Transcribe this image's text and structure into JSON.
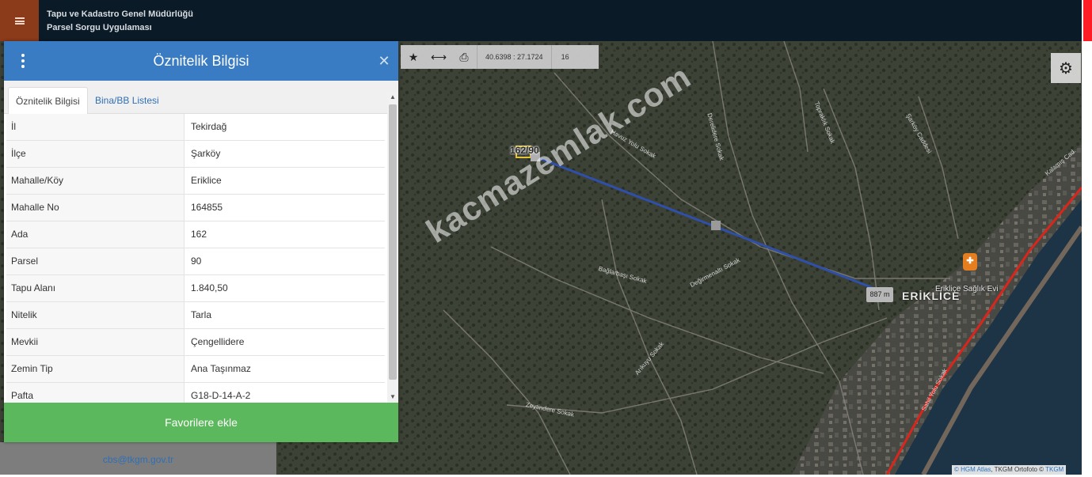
{
  "header": {
    "title_line1": "Tapu ve Kadastro Genel Müdürlüğü",
    "title_line2": "Parsel Sorgu Uygulaması",
    "menu_icon": "hamburger-icon"
  },
  "toolbar": {
    "icons": [
      "star-icon",
      "measure-icon",
      "print-icon"
    ],
    "coordinates": "40.6398 : 27.1724",
    "zoom": "16",
    "settings_icon": "gear-icon"
  },
  "map": {
    "parcel_label": "162/90",
    "distance_label": "887 m",
    "place_label": "ERİKLİCE",
    "poi_label": "Erikliçe Sağlık Evi",
    "watermark": "kacmazemlak.com",
    "streets": [
      "Havuz Yolu Sokak",
      "Derelidere Sokak",
      "Topraklık Sokak",
      "Şarköy Caddesi",
      "Değirmenaltı Sokak",
      "Bağlarbaşı Sokak",
      "Arıkuyu Sokak",
      "Zeytindere Sokak",
      "Sahil Yolu Sokak",
      "Kalamış Cad."
    ],
    "attribution_hgm": "© HGM Atlas",
    "attribution_rest": ", TKGM Ortofoto © ",
    "attribution_tkgm": "TKGM",
    "colors": {
      "measure_line": "#2f4fa8",
      "parcel_outline": "#e8c43a",
      "coast_line": "#d9261c",
      "sea": "#1d3346"
    }
  },
  "panel": {
    "title": "Öznitelik Bilgisi",
    "close_icon": "close-icon",
    "tabs": [
      {
        "label": "Öznitelik Bilgisi",
        "active": true
      },
      {
        "label": "Bina/BB Listesi",
        "active": false
      }
    ],
    "rows": [
      {
        "key": "İl",
        "value": "Tekirdağ"
      },
      {
        "key": "İlçe",
        "value": "Şarköy"
      },
      {
        "key": "Mahalle/Köy",
        "value": "Eriklice"
      },
      {
        "key": "Mahalle No",
        "value": "164855"
      },
      {
        "key": "Ada",
        "value": "162"
      },
      {
        "key": "Parsel",
        "value": "90"
      },
      {
        "key": "Tapu Alanı",
        "value": "1.840,50"
      },
      {
        "key": "Nitelik",
        "value": "Tarla"
      },
      {
        "key": "Mevkii",
        "value": "Çengellidere"
      },
      {
        "key": "Zemin Tip",
        "value": "Ana Taşınmaz"
      },
      {
        "key": "Pafta",
        "value": "G18-D-14-A-2"
      }
    ],
    "favorite_button": "Favorilere ekle",
    "colors": {
      "header": "#3a7cc3",
      "button": "#5cb85c"
    }
  },
  "footer": {
    "email": "cbs@tkgm.gov.tr"
  }
}
